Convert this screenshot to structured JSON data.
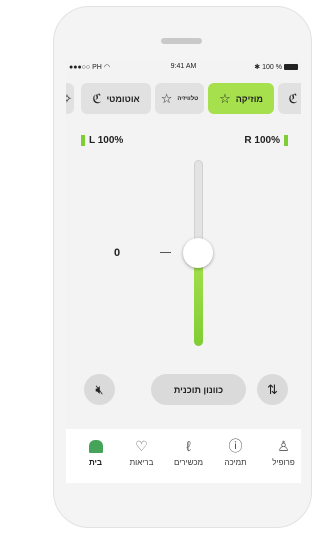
{
  "status_bar": {
    "carrier": "PH",
    "time": "9:41 AM",
    "battery": "100 %"
  },
  "programs": [
    {
      "label": "מוזיקה",
      "icon": "star-icon",
      "active": true
    },
    {
      "label": "טלוויזיה",
      "icon": "tv-star-icon",
      "active": false
    },
    {
      "label": "אוטומטי",
      "icon": "ear-icon",
      "active": false
    }
  ],
  "levels": {
    "left": "L 100%",
    "right": "R 100%"
  },
  "volume": {
    "value": "0",
    "level": 0.5
  },
  "controls": {
    "mute_icon": "mute-icon",
    "fine_tune_label": "כוונון תוכנית",
    "settings_icon": "equalizer-icon"
  },
  "tabs": [
    {
      "label": "פרופיל",
      "icon": "profile-icon",
      "active": false
    },
    {
      "label": "תמיכה",
      "icon": "support-icon",
      "active": false
    },
    {
      "label": "מכשירים",
      "icon": "devices-icon",
      "active": false
    },
    {
      "label": "בריאות",
      "icon": "health-icon",
      "active": false
    },
    {
      "label": "בית",
      "icon": "home-icon",
      "active": true
    }
  ],
  "colors": {
    "accent": "#a6e04d",
    "home": "#46a35a",
    "level": "#7fcd34"
  }
}
